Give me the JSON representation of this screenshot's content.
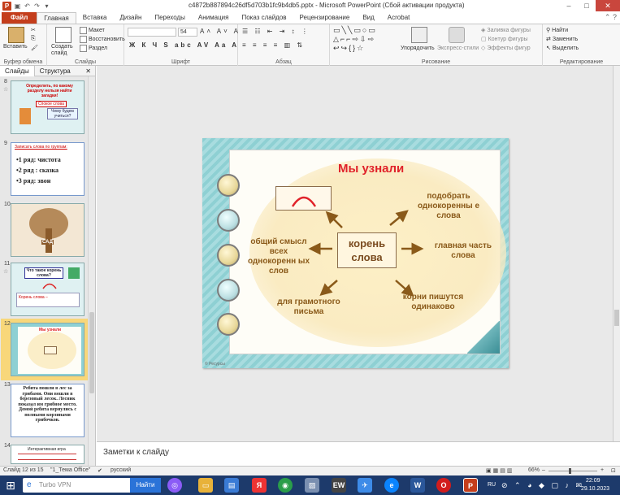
{
  "window": {
    "title": "c4872b887894c26df5d703b1fc9b4db5.pptx - Microsoft PowerPoint (Сбой активации продукта)",
    "min": "–",
    "max": "□",
    "close": "✕"
  },
  "ribbon_tabs": [
    "Файл",
    "Главная",
    "Вставка",
    "Дизайн",
    "Переходы",
    "Анимация",
    "Показ слайдов",
    "Рецензирование",
    "Вид",
    "Acrobat"
  ],
  "ribbon": {
    "paste": "Вставить",
    "clipboard_label": "Буфер обмена",
    "create_slide": "Создать слайд",
    "layout": "Макет",
    "reset": "Восстановить",
    "section": "Раздел",
    "slides_label": "Слайды",
    "font_name": "",
    "font_size": "54",
    "font_label": "Шрифт",
    "paragraph_label": "Абзац",
    "arrange": "Упорядочить",
    "quick_styles": "Экспресс-стили",
    "shape_fill": "Заливка фигуры",
    "shape_outline": "Контур фигуры",
    "shape_effects": "Эффекты фигур",
    "drawing_label": "Рисование",
    "find": "Найти",
    "replace": "Заменить",
    "select": "Выделить",
    "editing_label": "Редактирование"
  },
  "left_pane": {
    "tab_slides": "Слайды",
    "tab_outline": "Структура",
    "close": "✕",
    "slides": [
      {
        "num": "8",
        "lines": [
          "Определить, по какому",
          "разделу нельзя найти",
          "загадки!",
          "Спокое слова",
          "Чему будем учиться?"
        ]
      },
      {
        "num": "9",
        "lines": [
          "Записать слова по группам:",
          "•1 ряд: чистота",
          "•2 ряд : сказка",
          "•3 ряд: звон"
        ]
      },
      {
        "num": "10",
        "lines": [
          "САД"
        ]
      },
      {
        "num": "11",
        "lines": [
          "Что такое корень слова?",
          "Корень слова –"
        ]
      },
      {
        "num": "12",
        "lines": [
          "Мы узнали"
        ]
      },
      {
        "num": "13",
        "lines": [
          "Ребята пошли в лес за грибами. Они вошли в березовый лесок. Лесник показал им грибное место. Домой ребята вернулись с полными корзинами грибочков."
        ]
      },
      {
        "num": "14",
        "lines": [
          "Интерактивная игра"
        ]
      }
    ]
  },
  "slide": {
    "title": "Мы узнали",
    "root": "корень слова",
    "labels": {
      "top_right": "подобрать однокоренны е слова",
      "right": "главная часть слова",
      "bottom_right": "корни пишутся одинаково",
      "bottom": "для грамотного письма",
      "left": "общий смысл всех однокоренн ых слов"
    },
    "copyright": "© Ресурсы"
  },
  "notes_placeholder": "Заметки к слайду",
  "status": {
    "slide_info": "Слайд 12 из 15",
    "theme": "\"1_Тема Office\"",
    "language": "русский",
    "zoom": "66%"
  },
  "taskbar": {
    "search_text": "Turbo VPN",
    "search_button": "Найти",
    "lang": "RU",
    "time": "22:09",
    "date": "29.10.2023"
  }
}
